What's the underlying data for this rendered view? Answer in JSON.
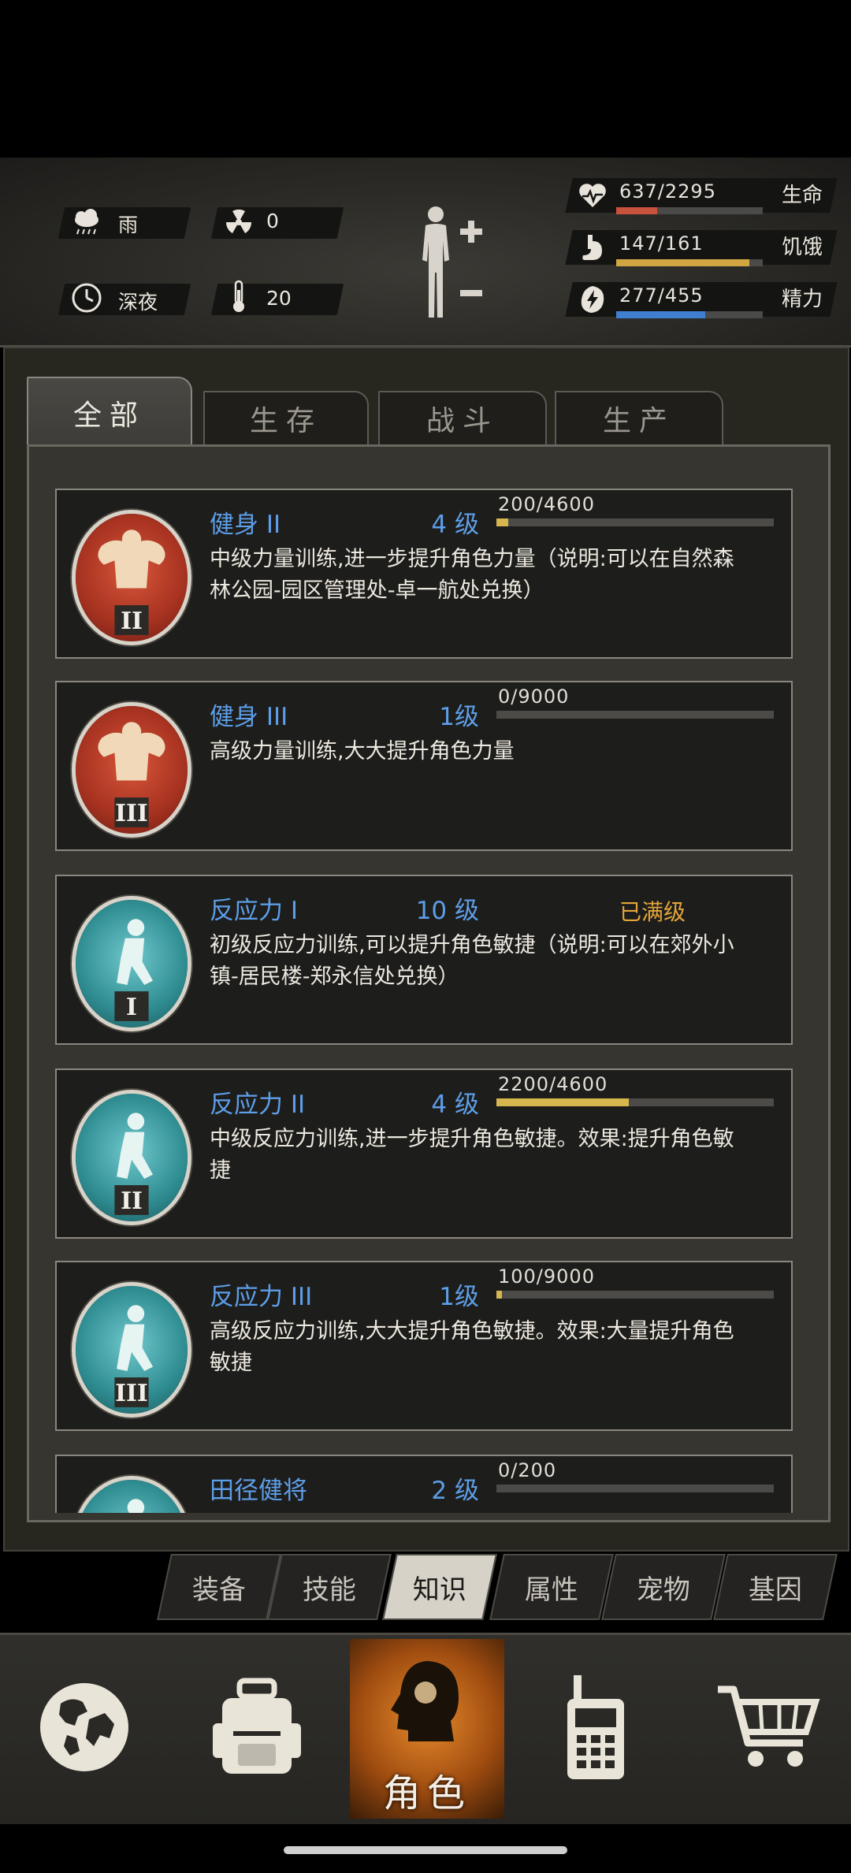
{
  "status": {
    "weather": "雨",
    "radiation": "0",
    "time_of_day": "深夜",
    "temperature": "20"
  },
  "vitals": [
    {
      "label": "生命",
      "value": "637/2295",
      "fill": 0.28,
      "color": "#c9523c",
      "icon": "heart-icon"
    },
    {
      "label": "饥饿",
      "value": "147/161",
      "fill": 0.91,
      "color": "#d0a542",
      "icon": "stomach-icon"
    },
    {
      "label": "精力",
      "value": "277/455",
      "fill": 0.61,
      "color": "#3f7fd0",
      "icon": "energy-icon"
    }
  ],
  "tabs": [
    "全部",
    "生存",
    "战斗",
    "生产"
  ],
  "active_tab": 0,
  "skills": [
    {
      "name": "健身 II",
      "level": "4 级",
      "progress": "200/4600",
      "fill": 0.043,
      "desc": "中级力量训练,进一步提升角色力量（说明:可以在自然森林公园-园区管理处-卓一航处兑换）",
      "icon": "strength-icon",
      "numeral": "II",
      "theme": "red"
    },
    {
      "name": "健身 III",
      "level": "1级",
      "progress": "0/9000",
      "fill": 0.0,
      "desc": "高级力量训练,大大提升角色力量",
      "icon": "strength-icon",
      "numeral": "III",
      "theme": "red"
    },
    {
      "name": "反应力 I",
      "level": "10 级",
      "max_label": "已满级",
      "desc": "初级反应力训练,可以提升角色敏捷（说明:可以在郊外小镇-居民楼-郑永信处兑换）",
      "icon": "agility-icon",
      "numeral": "I",
      "theme": "teal"
    },
    {
      "name": "反应力 II",
      "level": "4 级",
      "progress": "2200/4600",
      "fill": 0.478,
      "desc": "中级反应力训练,进一步提升角色敏捷。效果:提升角色敏捷",
      "icon": "agility-icon",
      "numeral": "II",
      "theme": "teal"
    },
    {
      "name": "反应力 III",
      "level": "1级",
      "progress": "100/9000",
      "fill": 0.011,
      "desc": "高级反应力训练,大大提升角色敏捷。效果:大量提升角色敏捷",
      "icon": "agility-icon",
      "numeral": "III",
      "theme": "teal"
    },
    {
      "name": "田径健将",
      "level": "2 级",
      "progress": "0/200",
      "fill": 0.0,
      "desc": "",
      "icon": "athlete-icon",
      "numeral": "",
      "theme": "teal"
    }
  ],
  "sub_tabs": [
    "装备",
    "技能",
    "知识",
    "属性",
    "宠物",
    "基因"
  ],
  "active_sub_tab": 2,
  "bottom_nav": [
    {
      "icon": "globe-icon",
      "label": ""
    },
    {
      "icon": "backpack-icon",
      "label": ""
    },
    {
      "icon": "character-icon",
      "label": "角色"
    },
    {
      "icon": "walkie-talkie-icon",
      "label": ""
    },
    {
      "icon": "shopping-cart-icon",
      "label": ""
    }
  ]
}
